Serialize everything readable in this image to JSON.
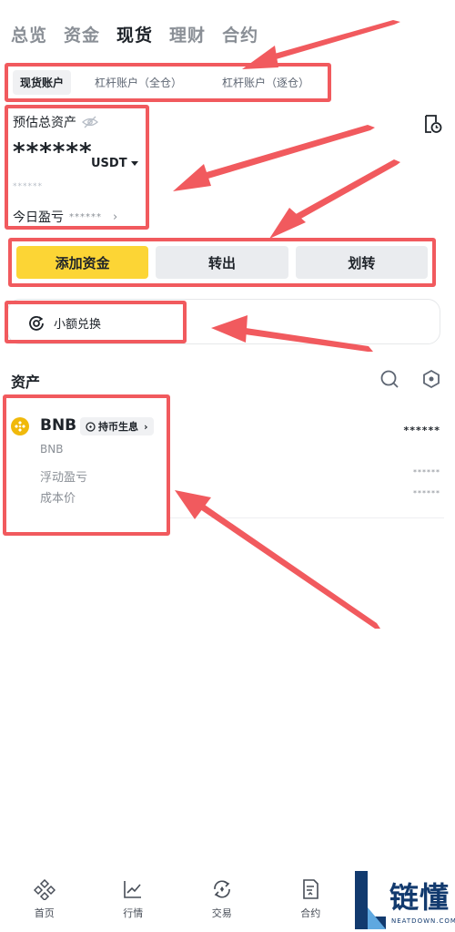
{
  "top_tabs": [
    "总览",
    "资金",
    "现货",
    "理财",
    "合约"
  ],
  "active_top_tab": "现货",
  "sub_tabs": [
    "现货账户",
    "杠杆账户（全仓）",
    "杠杆账户（逐仓）"
  ],
  "balance": {
    "label": "预估总资产",
    "amount": "******",
    "currency": "USDT",
    "fiat": "******",
    "today_pnl_label": "今日盈亏",
    "today_pnl_value": "******"
  },
  "actions": {
    "add_funds": "添加资金",
    "withdraw": "转出",
    "transfer": "划转"
  },
  "convert": {
    "label": "小额兑换"
  },
  "assets": {
    "title": "资产",
    "items": [
      {
        "symbol": "BNB",
        "name": "BNB",
        "badge": "持币生息",
        "balance": "******",
        "pnl_label": "浮动盈亏",
        "pnl_value": "******",
        "cost_label": "成本价",
        "cost_value": "******"
      }
    ]
  },
  "bottom_nav": [
    "首页",
    "行情",
    "交易",
    "合约"
  ],
  "watermark": {
    "title": "链懂",
    "subtitle": "NEATDOWN.COM"
  },
  "colors": {
    "accent_yellow": "#fcd535",
    "annotation_red": "#f15a5e",
    "bnb_gold": "#f0b90b",
    "watermark_blue": "#123a6e"
  }
}
